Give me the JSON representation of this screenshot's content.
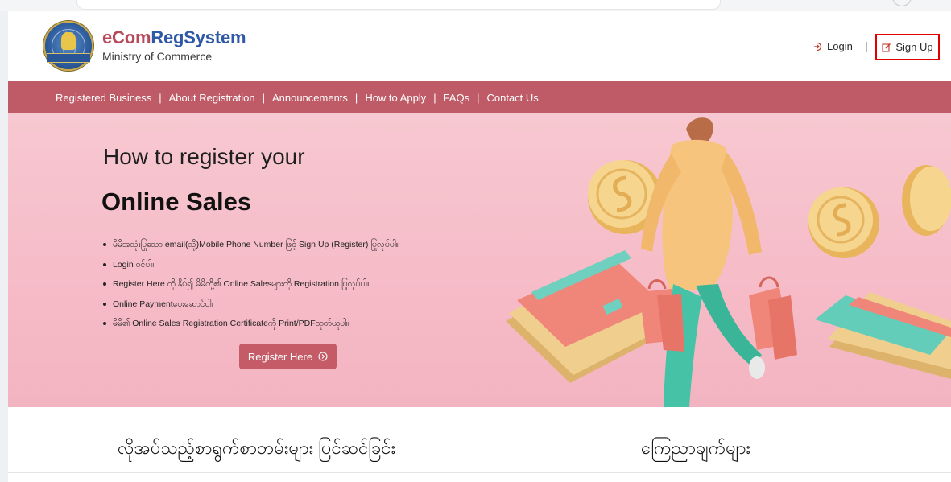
{
  "header": {
    "brand_part1": "eCom",
    "brand_part2": "RegSystem",
    "subtitle": "Ministry of Commerce",
    "seal_text": "COMMERCE",
    "login_label": "Login",
    "separator": "|",
    "signup_label": "Sign Up"
  },
  "nav": {
    "items": [
      "Registered Business",
      "About Registration",
      "Announcements",
      "How to Apply",
      "FAQs",
      "Contact Us"
    ],
    "separator": "|"
  },
  "hero": {
    "heading": "How to register your",
    "title": "Online Sales",
    "steps": [
      "မိမိအသုံးပြုသော email(သို့)Mobile Phone Number ဖြင့် Sign Up (Register) ပြုလုပ်ပါ။",
      "Login ဝင်ပါ။",
      "Register Here ကို နှိပ်၍ မိမိတို့၏ Online Salesများကို Registration ပြုလုပ်ပါ။",
      "Online Paymentပေးဆောင်ပါ။",
      "မိမိ၏ Online Sales Registration Certificateကို Print/PDFထုတ်ယူပါ။"
    ],
    "register_label": "Register Here"
  },
  "sections": {
    "left_title": "လိုအပ်သည့်စာရွက်စာတမ်းများ ပြင်ဆင်ခြင်း",
    "right_title": "ကြေညာချက်များ"
  },
  "colors": {
    "brand_red": "#b74a5a",
    "brand_blue": "#2f58a6",
    "nav_bg": "#bf5b67",
    "hero_bg": "#f6bcc8",
    "signup_highlight": "#e00000"
  },
  "icons": {
    "login": "login-icon",
    "signup": "edit-icon",
    "register": "circle-chevron-right-icon"
  }
}
